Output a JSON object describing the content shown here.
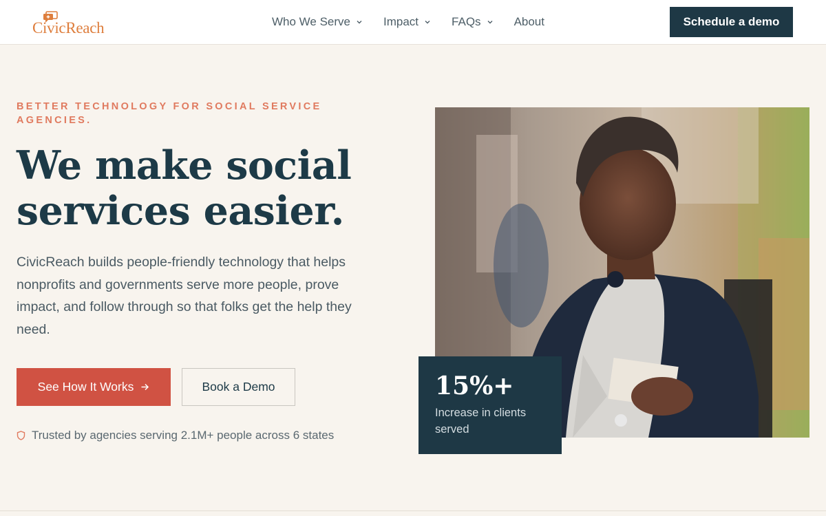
{
  "header": {
    "logo_text": "CivicReach",
    "nav": [
      {
        "label": "Who We Serve",
        "has_dropdown": true
      },
      {
        "label": "Impact",
        "has_dropdown": true
      },
      {
        "label": "FAQs",
        "has_dropdown": true
      },
      {
        "label": "About",
        "has_dropdown": false
      }
    ],
    "cta_label": "Schedule a demo"
  },
  "hero": {
    "eyebrow": "BETTER TECHNOLOGY FOR SOCIAL SERVICE AGENCIES.",
    "headline_line1": "We make social",
    "headline_line2": "services easier.",
    "body": "CivicReach builds people-friendly technology that helps nonprofits and governments serve more people, prove impact, and follow through so that folks get the help they need.",
    "primary_button": "See How It Works",
    "secondary_button": "Book a Demo",
    "trust_text": "Trusted by agencies serving 2.1M+ people across 6 states"
  },
  "stat": {
    "value": "15%+",
    "label": "Increase in clients served"
  },
  "colors": {
    "background": "#f8f4ee",
    "navy": "#1e3845",
    "accent_red": "#d05243",
    "eyebrow_coral": "#e07a5f",
    "logo_orange": "#de7e3d"
  },
  "icons": {
    "logo": "speech-bubble-plus-icon",
    "dropdown": "chevron-down-icon",
    "arrow": "arrow-right-icon",
    "trust": "shield-icon"
  }
}
